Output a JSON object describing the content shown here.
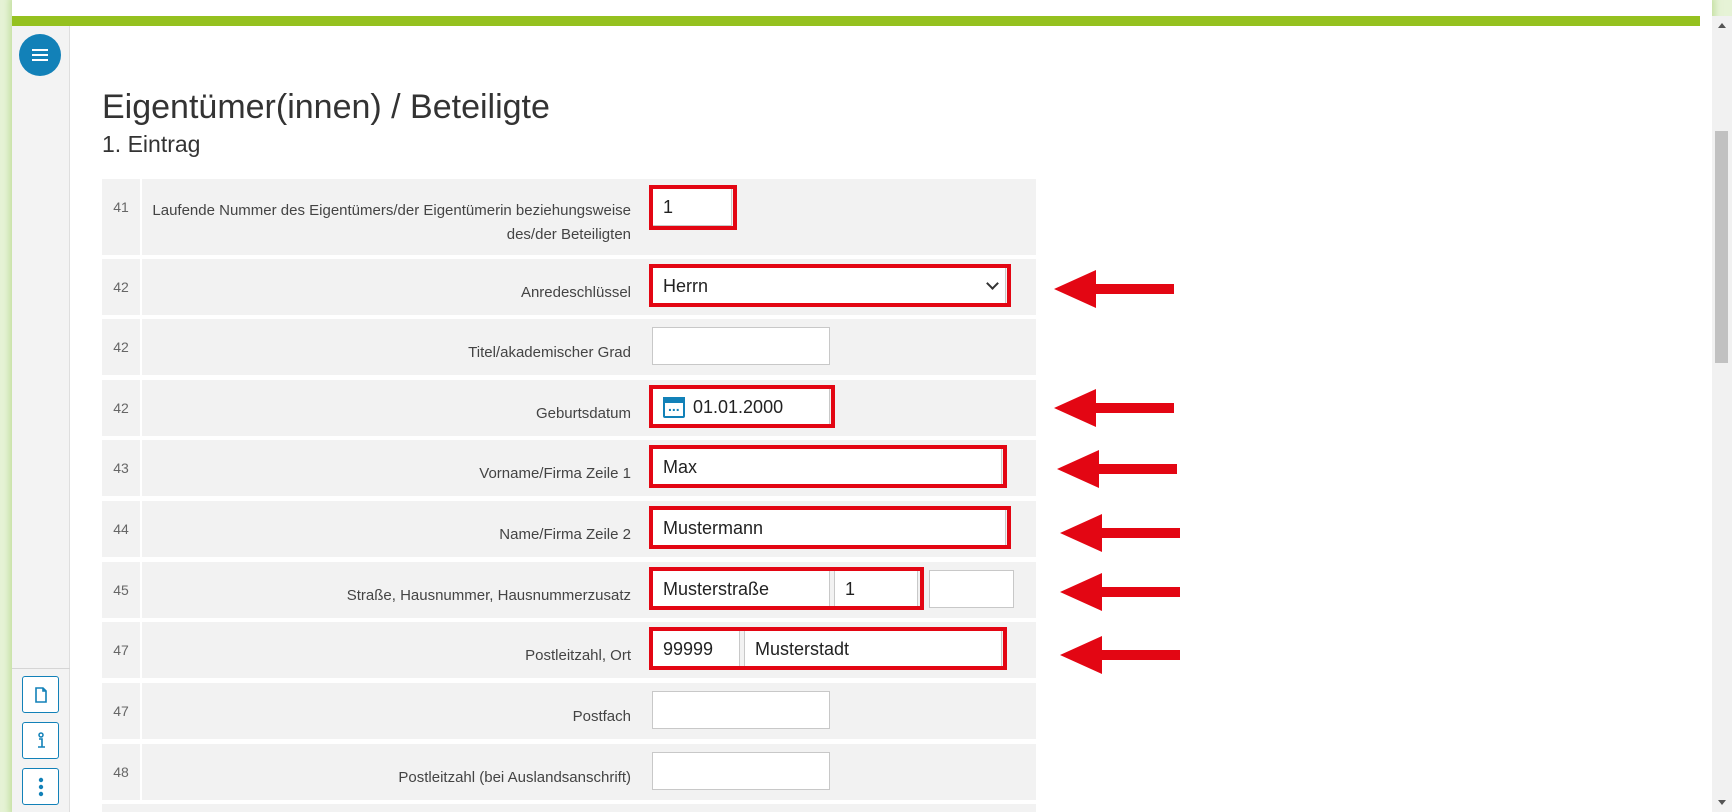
{
  "page": {
    "title": "Eigentümer(innen) / Beteiligte",
    "subtitle": "1. Eintrag"
  },
  "colors": {
    "accent": "#95c11f",
    "primary": "#1281b8",
    "highlight": "#e30613"
  },
  "sidebar": {
    "menu_icon": "hamburger-icon",
    "bottom_buttons": [
      "document-icon",
      "info-icon",
      "more-vertical-icon"
    ]
  },
  "form": {
    "rows": [
      {
        "num": "41",
        "label": "Laufende Nummer des Eigentümers/der Eigentümerin beziehungsweise des/der Beteiligten",
        "value": "1"
      },
      {
        "num": "42",
        "label": "Anredeschlüssel",
        "value": "Herrn"
      },
      {
        "num": "42",
        "label": "Titel/akademischer Grad",
        "value": ""
      },
      {
        "num": "42",
        "label": "Geburtsdatum",
        "value": "01.01.2000"
      },
      {
        "num": "43",
        "label": "Vorname/Firma Zeile 1",
        "value": "Max"
      },
      {
        "num": "44",
        "label": "Name/Firma Zeile 2",
        "value": "Mustermann"
      },
      {
        "num": "45",
        "label": "Straße,  Hausnummer,  Hausnummerzusatz",
        "street": "Musterstraße",
        "house": "1",
        "suffix": ""
      },
      {
        "num": "47",
        "label": "Postleitzahl,  Ort",
        "zip": "99999",
        "city": "Musterstadt"
      },
      {
        "num": "47",
        "label": "Postfach",
        "value": ""
      },
      {
        "num": "48",
        "label": "Postleitzahl (bei Auslandsanschrift)",
        "value": ""
      }
    ]
  }
}
